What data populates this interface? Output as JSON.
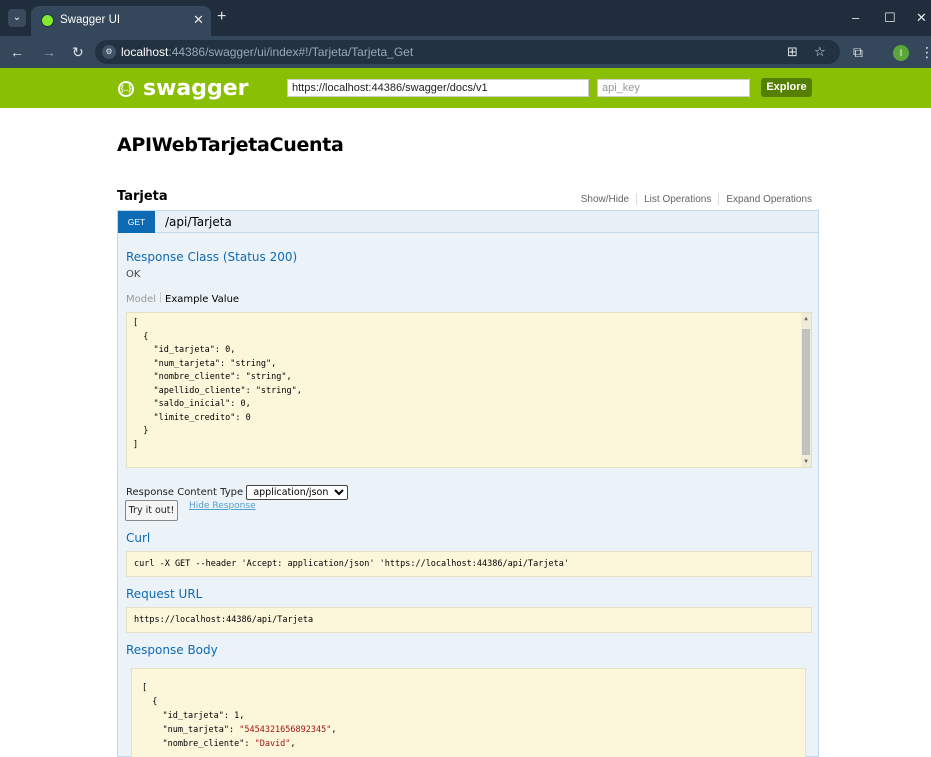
{
  "browser": {
    "tab_title": "Swagger UI",
    "url_host": "localhost",
    "url_rest": ":44386/swagger/ui/index#!/Tarjeta/Tarjeta_Get",
    "profile_initial": "I"
  },
  "header": {
    "logo_text": "swagger",
    "spec_url": "https://localhost:44386/swagger/docs/v1",
    "api_key_placeholder": "api_key",
    "explore_label": "Explore"
  },
  "api": {
    "title": "APIWebTarjetaCuenta"
  },
  "resource": {
    "name": "Tarjeta",
    "links": [
      "Show/Hide",
      "List Operations",
      "Expand Operations"
    ]
  },
  "operation": {
    "method": "GET",
    "path": "/api/Tarjeta",
    "response_class_heading": "Response Class (Status 200)",
    "response_class_status": "OK",
    "model_tab": "Model",
    "example_value_tab": "Example Value",
    "example_lines": [
      "[",
      "  {",
      "    \"id_tarjeta\": 0,",
      "    \"num_tarjeta\": \"string\",",
      "    \"nombre_cliente\": \"string\",",
      "    \"apellido_cliente\": \"string\",",
      "    \"saldo_inicial\": 0,",
      "    \"limite_credito\": 0",
      "  }",
      "]"
    ],
    "response_content_type_label": "Response Content Type",
    "response_content_type_value": "application/json",
    "try_button": "Try it out!",
    "hide_response": "Hide Response",
    "curl_heading": "Curl",
    "curl_command": "curl -X GET --header 'Accept: application/json' 'https://localhost:44386/api/Tarjeta'",
    "request_url_heading": "Request URL",
    "request_url": "https://localhost:44386/api/Tarjeta",
    "response_body_heading": "Response Body",
    "response_body": {
      "open_bracket": "[",
      "open_brace": "  {",
      "key_id": "    \"id_tarjeta\": ",
      "val_id": "1,",
      "key_num": "    \"num_tarjeta\": ",
      "val_num": "\"5454321656892345\"",
      "comma_num": ",",
      "key_nombre": "    \"nombre_cliente\": ",
      "val_nombre": "\"David\"",
      "comma_nombre": ","
    }
  }
}
